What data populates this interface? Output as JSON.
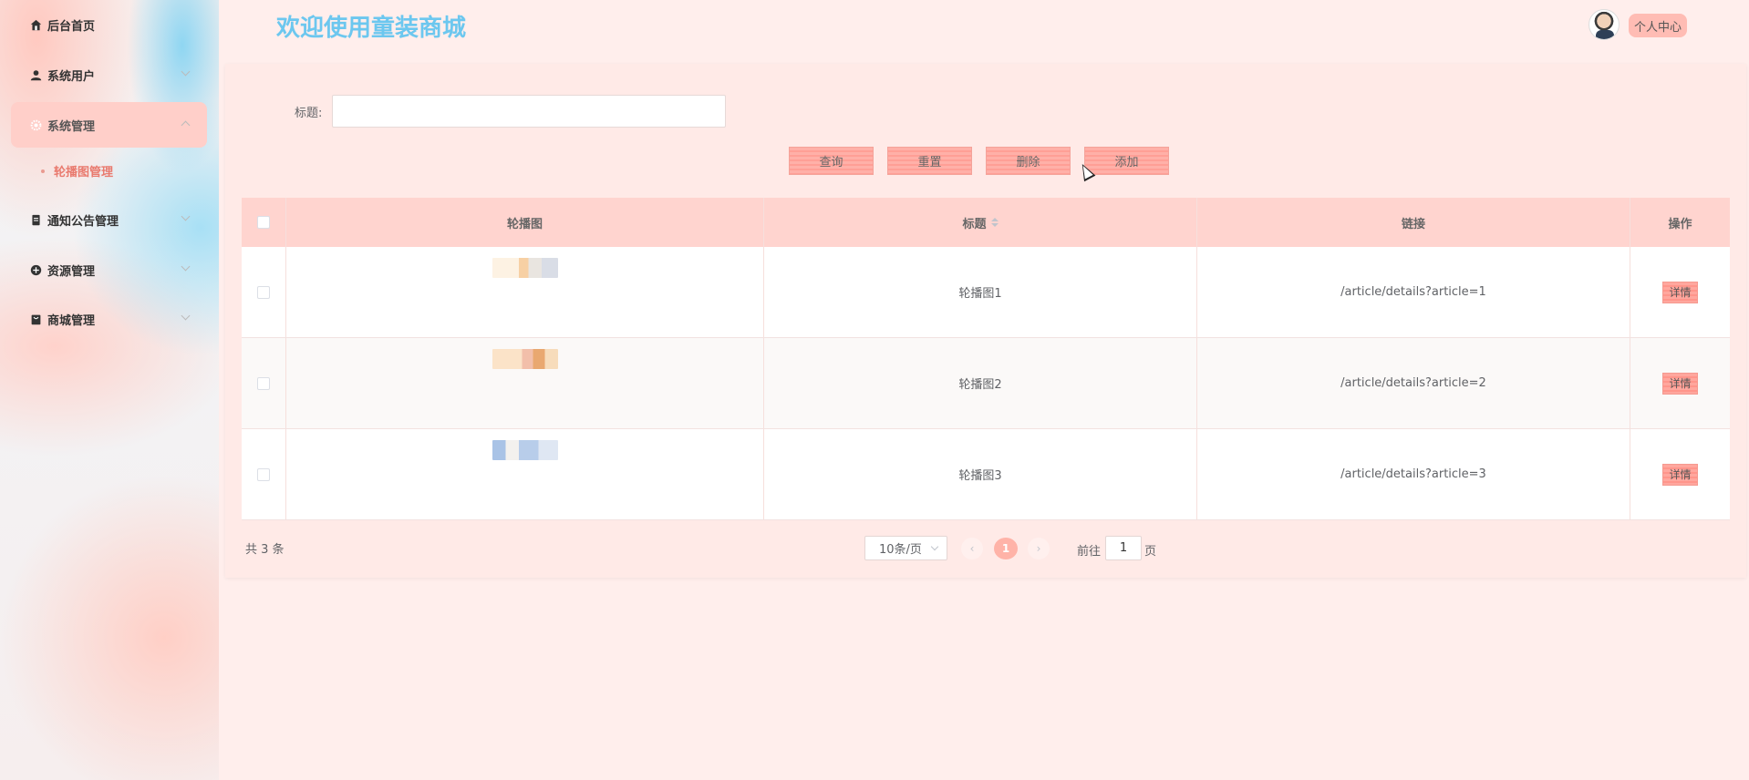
{
  "sidebar": {
    "items": [
      {
        "label": "后台首页",
        "icon": "home-icon"
      },
      {
        "label": "系统用户",
        "icon": "user-icon"
      },
      {
        "label": "系统管理",
        "icon": "gear-icon",
        "active": true
      },
      {
        "label": "通知公告管理",
        "icon": "document-icon"
      },
      {
        "label": "资源管理",
        "icon": "plus-circle-icon"
      },
      {
        "label": "商城管理",
        "icon": "shopping-bag-icon"
      }
    ],
    "submenu": {
      "label": "轮播图管理"
    }
  },
  "header": {
    "title": "欢迎使用童装商城",
    "user_center_label": "个人中心"
  },
  "search": {
    "title_label": "标题:",
    "title_value": "",
    "buttons": {
      "query": "查询",
      "reset": "重置",
      "delete": "删除",
      "add": "添加"
    }
  },
  "table": {
    "columns": [
      "轮播图",
      "标题",
      "链接",
      "操作"
    ],
    "rows": [
      {
        "image": "轮播图1 thumbnail",
        "title": "轮播图1",
        "link": "/article/details?article=1",
        "action": "详情"
      },
      {
        "image": "轮播图2 thumbnail",
        "title": "轮播图2",
        "link": "/article/details?article=2",
        "action": "详情"
      },
      {
        "image": "轮播图3 thumbnail",
        "title": "轮播图3",
        "link": "/article/details?article=3",
        "action": "详情"
      }
    ]
  },
  "pagination": {
    "total_text": "共 3 条",
    "page_size": "10条/页",
    "current_page": "1",
    "goto_label": "前往",
    "goto_value": "1",
    "goto_suffix": "页"
  },
  "colors": {
    "accent": "#ffb3a8",
    "title": "#6cc7ef",
    "background": "#ffeeec"
  }
}
